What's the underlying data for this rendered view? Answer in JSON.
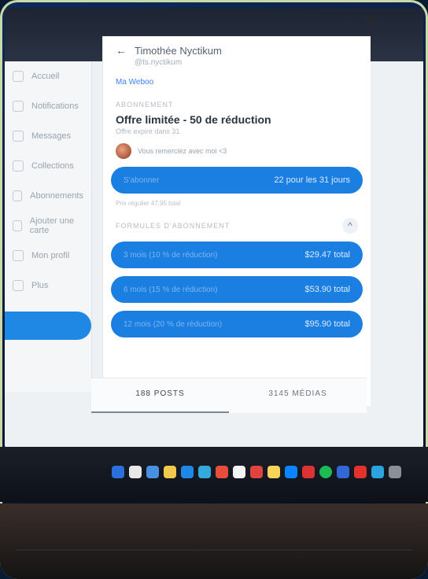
{
  "browser": {
    "icons": [
      "star-icon",
      "edit-icon",
      "more-icon"
    ]
  },
  "nav": {
    "items": [
      {
        "label": "Accueil",
        "icon": "home-icon"
      },
      {
        "label": "Notifications",
        "icon": "bell-icon"
      },
      {
        "label": "Messages",
        "icon": "mail-icon"
      },
      {
        "label": "Collections",
        "icon": "bookmark-icon"
      },
      {
        "label": "Abonnements",
        "icon": "users-icon"
      },
      {
        "label": "Ajouter une carte",
        "icon": "card-icon"
      },
      {
        "label": "Mon profil",
        "icon": "user-icon"
      },
      {
        "label": "Plus",
        "icon": "more-icon"
      }
    ],
    "active_label": ""
  },
  "profile": {
    "name": "Timothée Nyctikum",
    "handle": "@ts.nyctikum",
    "link": "Ma Weboo"
  },
  "offer": {
    "section": "ABONNEMENT",
    "title": "Offre limitée - 50 de réduction",
    "subtitle": "Offre expire dans 31",
    "author": "Vous remerciez avec moi <3",
    "primary_pill_left": "S'abonner",
    "primary_pill_right": "22 pour les 31 jours",
    "note": "Prix régulier 47,95 total"
  },
  "bundles": {
    "section": "FORMULES D'ABONNEMENT",
    "items": [
      {
        "left": "3 mois (10 % de réduction)",
        "right": "$29.47 total"
      },
      {
        "left": "6 mois (15 % de réduction)",
        "right": "$53.90 total"
      },
      {
        "left": "12 mois (20 % de réduction)",
        "right": "$95.90 total"
      }
    ]
  },
  "tabs": {
    "posts": "188 POSTS",
    "media": "3145 MÉDIAS"
  },
  "colors": {
    "accent": "#1a7fe0",
    "screen_bg": "#eef1f4"
  }
}
